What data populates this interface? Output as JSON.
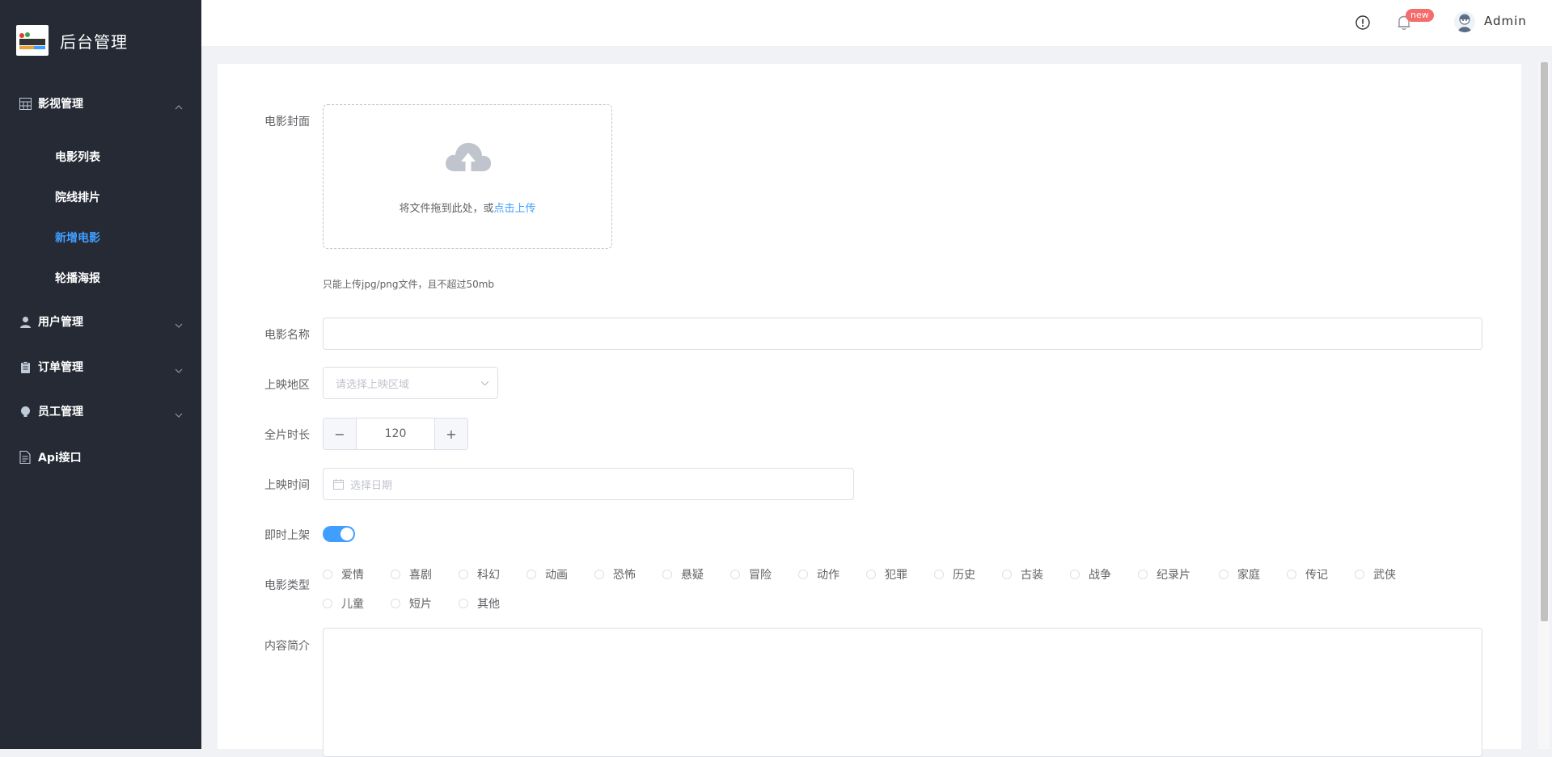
{
  "app": {
    "title": "后台管理"
  },
  "sidebar": {
    "groups": [
      {
        "label": "影视管理",
        "icon": "grid-icon",
        "expanded": true,
        "items": [
          {
            "label": "电影列表",
            "active": false
          },
          {
            "label": "院线排片",
            "active": false
          },
          {
            "label": "新增电影",
            "active": true
          },
          {
            "label": "轮播海报",
            "active": false
          }
        ]
      },
      {
        "label": "用户管理",
        "icon": "user-icon",
        "expanded": false
      },
      {
        "label": "订单管理",
        "icon": "clipboard-icon",
        "expanded": false
      },
      {
        "label": "员工管理",
        "icon": "bulb-icon",
        "expanded": false
      },
      {
        "label": "Api接口",
        "icon": "document-icon"
      }
    ]
  },
  "header": {
    "badge": "new",
    "user_name": "Admin"
  },
  "form": {
    "cover": {
      "label": "电影封面",
      "drop_text": "将文件拖到此处，或",
      "upload_link": "点击上传",
      "tip": "只能上传jpg/png文件，且不超过50mb"
    },
    "name": {
      "label": "电影名称",
      "value": "",
      "placeholder": ""
    },
    "region": {
      "label": "上映地区",
      "placeholder": "请选择上映区域"
    },
    "duration": {
      "label": "全片时长",
      "value": "120",
      "minus": "−",
      "plus": "+"
    },
    "release_date": {
      "label": "上映时间",
      "placeholder": "选择日期"
    },
    "instant_listing": {
      "label": "即时上架",
      "on": true
    },
    "genre": {
      "label": "电影类型",
      "options": [
        "爱情",
        "喜剧",
        "科幻",
        "动画",
        "恐怖",
        "悬疑",
        "冒险",
        "动作",
        "犯罪",
        "历史",
        "古装",
        "战争",
        "纪录片",
        "家庭",
        "传记",
        "武侠",
        "儿童",
        "短片",
        "其他"
      ]
    },
    "synopsis": {
      "label": "内容简介",
      "value": ""
    }
  },
  "colors": {
    "sidebar_bg": "#252a35",
    "accent": "#409eff",
    "badge": "#f56c6c"
  }
}
